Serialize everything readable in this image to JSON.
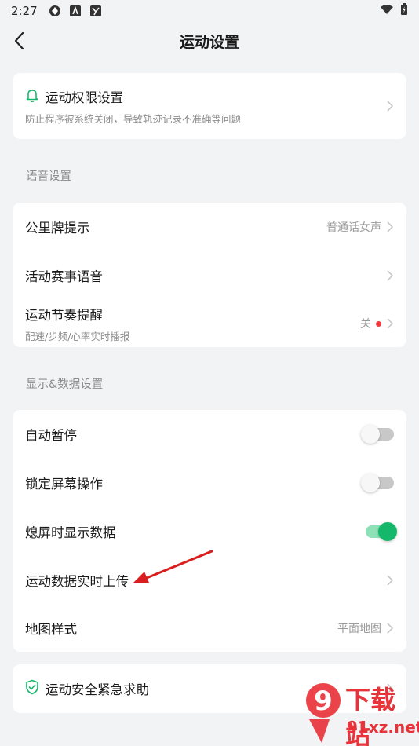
{
  "status_bar": {
    "time": "2:27"
  },
  "header": {
    "title": "运动设置"
  },
  "permission_card": {
    "title": "运动权限设置",
    "subtitle": "防止程序被系统关闭，导致轨迹记录不准确等问题"
  },
  "voice_section": {
    "title": "语音设置",
    "items": [
      {
        "label": "公里牌提示",
        "value": "普通话女声"
      },
      {
        "label": "活动赛事语音"
      },
      {
        "label": "运动节奏提醒",
        "subtitle": "配速/步频/心率实时播报",
        "value": "关"
      }
    ]
  },
  "display_section": {
    "title": "显示&数据设置",
    "items": [
      {
        "label": "自动暂停",
        "toggle": false
      },
      {
        "label": "锁定屏幕操作",
        "toggle": false
      },
      {
        "label": "熄屏时显示数据",
        "toggle": true
      },
      {
        "label": "运动数据实时上传"
      },
      {
        "label": "地图样式",
        "value": "平面地图"
      }
    ]
  },
  "safety_card": {
    "title": "运动安全紧急求助"
  },
  "watermark": {
    "brand": "下载站",
    "domain": "91xz.net",
    "logo_digit": "9"
  },
  "colors": {
    "accent": "#15b86a",
    "background": "#f2f3f5",
    "dot": "#f23a3a",
    "arrow": "#d81e1e"
  }
}
